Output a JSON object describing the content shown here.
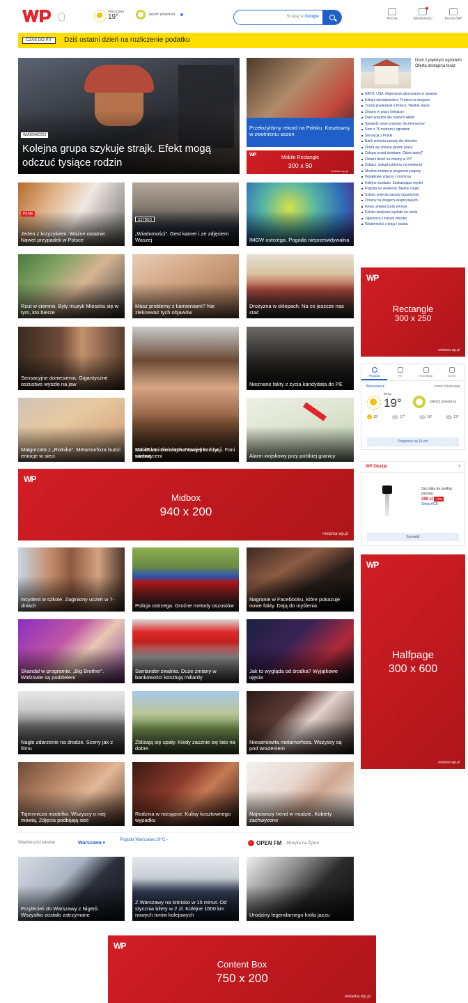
{
  "header": {
    "weather_label": "Warszawa",
    "weather_temp": "19°",
    "air_label": "Jakość powietrza",
    "search_placeholder": "Szukaj w",
    "search_engine": "Google",
    "links": [
      {
        "label": "Poczta"
      },
      {
        "label": "Wiadomości"
      },
      {
        "label": "Poczta WP"
      }
    ]
  },
  "alert": {
    "tag": "CZAS DO PIT",
    "text": "Dziś ostatni dzień na rozliczenie podatku"
  },
  "hero": {
    "label": "WIADOMOŚCI",
    "title": "Kolejna grupa szykuje strajk. Efekt mogą odczuć tysiące rodzin"
  },
  "sideTop": {
    "caption": "Przełożyliśmy rekord na Polsku. Kosztowny w zwolnieniu sezon",
    "ad_name": "Mobile Rectangle",
    "ad_size": "300 x 50",
    "ad_foot": "reklama wp.pl"
  },
  "grid1": [
    {
      "caption": "Jeden z krzyżykiem. Ważne ostatnie. Nawet przypadek w Polsce",
      "label": "PILNE"
    },
    {
      "caption": "„Wiadomości”. Gest kamer i ze zdjęciem Waszej",
      "label": "SZYBKO"
    },
    {
      "caption": "IMGW ostrzega. Pogoda nieprzewidywalna",
      "label": ""
    }
  ],
  "grid2": [
    {
      "caption": "Rzut w ciemno. Były muzyk Mieszka się w tym, kto bierze",
      "label": ""
    },
    {
      "caption": "Masz problemy z kamieniami? Nie zlekceważ tych objawów",
      "label": ""
    },
    {
      "caption": "Drożyzna w sklepach. Na co jeszcze nas stać",
      "label": ""
    }
  ],
  "grid3": [
    {
      "caption": "Sensacyjne doniesienia. Gigantyczne oszustwo wyszło na jaw",
      "label": ""
    },
    {
      "caption": "Kobieta w okularach. Nowy trend na wiosnę",
      "label": ""
    },
    {
      "caption": "Nieznane fakty z życia kandydata do PE",
      "label": ""
    }
  ],
  "grid4": [
    {
      "caption": "Małgorzata z „Rolnika”. Metamorfoza budzi emocje w sieci",
      "label": ""
    },
    {
      "caption": "Ma 46 lat i nie ukrywa swojej kondycji. Fani zachwyceni",
      "label": ""
    },
    {
      "caption": "Alarm wojskowy przy polskiej granicy",
      "label": ""
    }
  ],
  "midbox": {
    "name": "Midbox",
    "size": "940 x 200",
    "foot": "reklama wp.pl"
  },
  "grid5": [
    {
      "caption": "Incydent w szkole. Zaginiony uczeń w 7-dniach",
      "label": ""
    },
    {
      "caption": "Policja ostrzega. Groźne metody oszustów",
      "label": ""
    },
    {
      "caption": "Nagranie w Facebooku, które pokazuje nowe fakty. Dają do myślenia",
      "label": ""
    }
  ],
  "grid6": [
    {
      "caption": "Skandal w programie. „Big Brother”. Widzowie są podzieleni",
      "label": ""
    },
    {
      "caption": "Santander zwalnia. Duże zmiany w bankowości kosztują miliardy",
      "label": ""
    },
    {
      "caption": "Jak to wygląda od środka? Wyjątkowe ujęcia",
      "label": ""
    }
  ],
  "grid7": [
    {
      "caption": "Nagłe zdarzenie na drodze. Sceny jak z filmu",
      "label": ""
    },
    {
      "caption": "Zbliżają się upały. Kiedy zacznie się lato na dobre",
      "label": ""
    },
    {
      "caption": "Niesamowita metamorfoza. Wszyscy są pod wrażeniem",
      "label": ""
    }
  ],
  "grid8": [
    {
      "caption": "Tajemnicza modelka. Wszyscy o niej mówią. Zdjęcia podbijają sieć",
      "label": ""
    },
    {
      "caption": "Rodzina w rozsypce. Kulisy kosztownego wypadku",
      "label": ""
    },
    {
      "caption": "Najnowszy trend w modzie. Kobiety zachwycone",
      "label": ""
    }
  ],
  "local": {
    "label": "Wiadomości lokalne",
    "city": "Warszawa ▾",
    "weather_link": "Pogoda Warszawa 19°C ›",
    "radio_name": "OPEN FM",
    "radio_sub": "Muzyka na Żywo!"
  },
  "grid9": [
    {
      "caption": "Przylecieli do Warszawy z Nigerii. Wszystko zostało zatrzymane",
      "label": ""
    },
    {
      "caption": "Z Warszawy na lotnisko w 15 minut. Od stycznia bilety w 2 zł. Kolejne 1600 km nowych torów kolejowych",
      "label": ""
    },
    {
      "caption": "Urodziny legendarnego króla jazzu",
      "label": ""
    }
  ],
  "contentBox": {
    "name": "Content Box",
    "size": "750 x 200",
    "foot": "reklama wp.pl"
  },
  "rightPromo": {
    "text": "Dom z pięknym ogrodem. Oferta dostępna teraz"
  },
  "newsList": [
    "NATO, USA. Najnowsze głosowanie w sprawie",
    "Kolejni niezadowoleni. Protest na drogach",
    "Trump powiedział o Polsce. Wielkie słowa",
    "Zmiany w pracy kolejarzy",
    "Dwie potężne siły nowych władz",
    "Sprawdź nowe przepisy dla kierowców",
    "Dom z 75 metrami i ogrodem",
    "Sensacja z Polski",
    "Bank zmienia zasady dla klientów",
    "Zbliża się zmiana godzin pracy",
    "Zakupy przed świętami. Gdzie taniej?",
    "Ostatni dzień na zmiany w PIT",
    "Zobacz, dokąd jeździmy na weekend",
    "Mroźna zmiana w prognozie pogody",
    "Wyjątkowe zdjęcia z kosmosu",
    "Kolejne sondaże. Zaskakujące wyniki",
    "Pogoda na weekend. Będzie ciepło",
    "Szkoła zmienia zasady egzaminów",
    "Zmiany na drogach ekspresowych",
    "Nowa ustawa budzi emocje",
    "Polska zwiększa wydatki na armię",
    "Tajemnica z historii zbrodni",
    "Wiadomości z kraju i świata"
  ],
  "rightAd1": {
    "name": "Rectangle",
    "size": "300 x 250",
    "foot": "reklama wp.pl"
  },
  "weatherBox": {
    "tabs": [
      {
        "label": "Pogoda"
      },
      {
        "label": "TV"
      },
      {
        "label": "Horoskop"
      },
      {
        "label": "Kursy"
      }
    ],
    "location": "Warszawa ▾",
    "sublocation": "zmień lokalizację",
    "temp": "19°",
    "temp_label": "teraz",
    "air": "Jakość powietrza",
    "forecast": [
      {
        "label": "15°"
      },
      {
        "label": "17°"
      },
      {
        "label": "18°"
      },
      {
        "label": "13°"
      }
    ],
    "button": "Prognoza na 16 dni"
  },
  "shop": {
    "label": "WP Okazje",
    "plus": "+",
    "product": "Szczotka do podłóg parowa",
    "price": "299 zł",
    "promo": "-10%",
    "shop_name": "Sklep AGD",
    "button": "Sprawdź"
  },
  "rightAd2": {
    "name": "Halfpage",
    "size": "300 x 600",
    "foot": "reklama wp.pl"
  }
}
